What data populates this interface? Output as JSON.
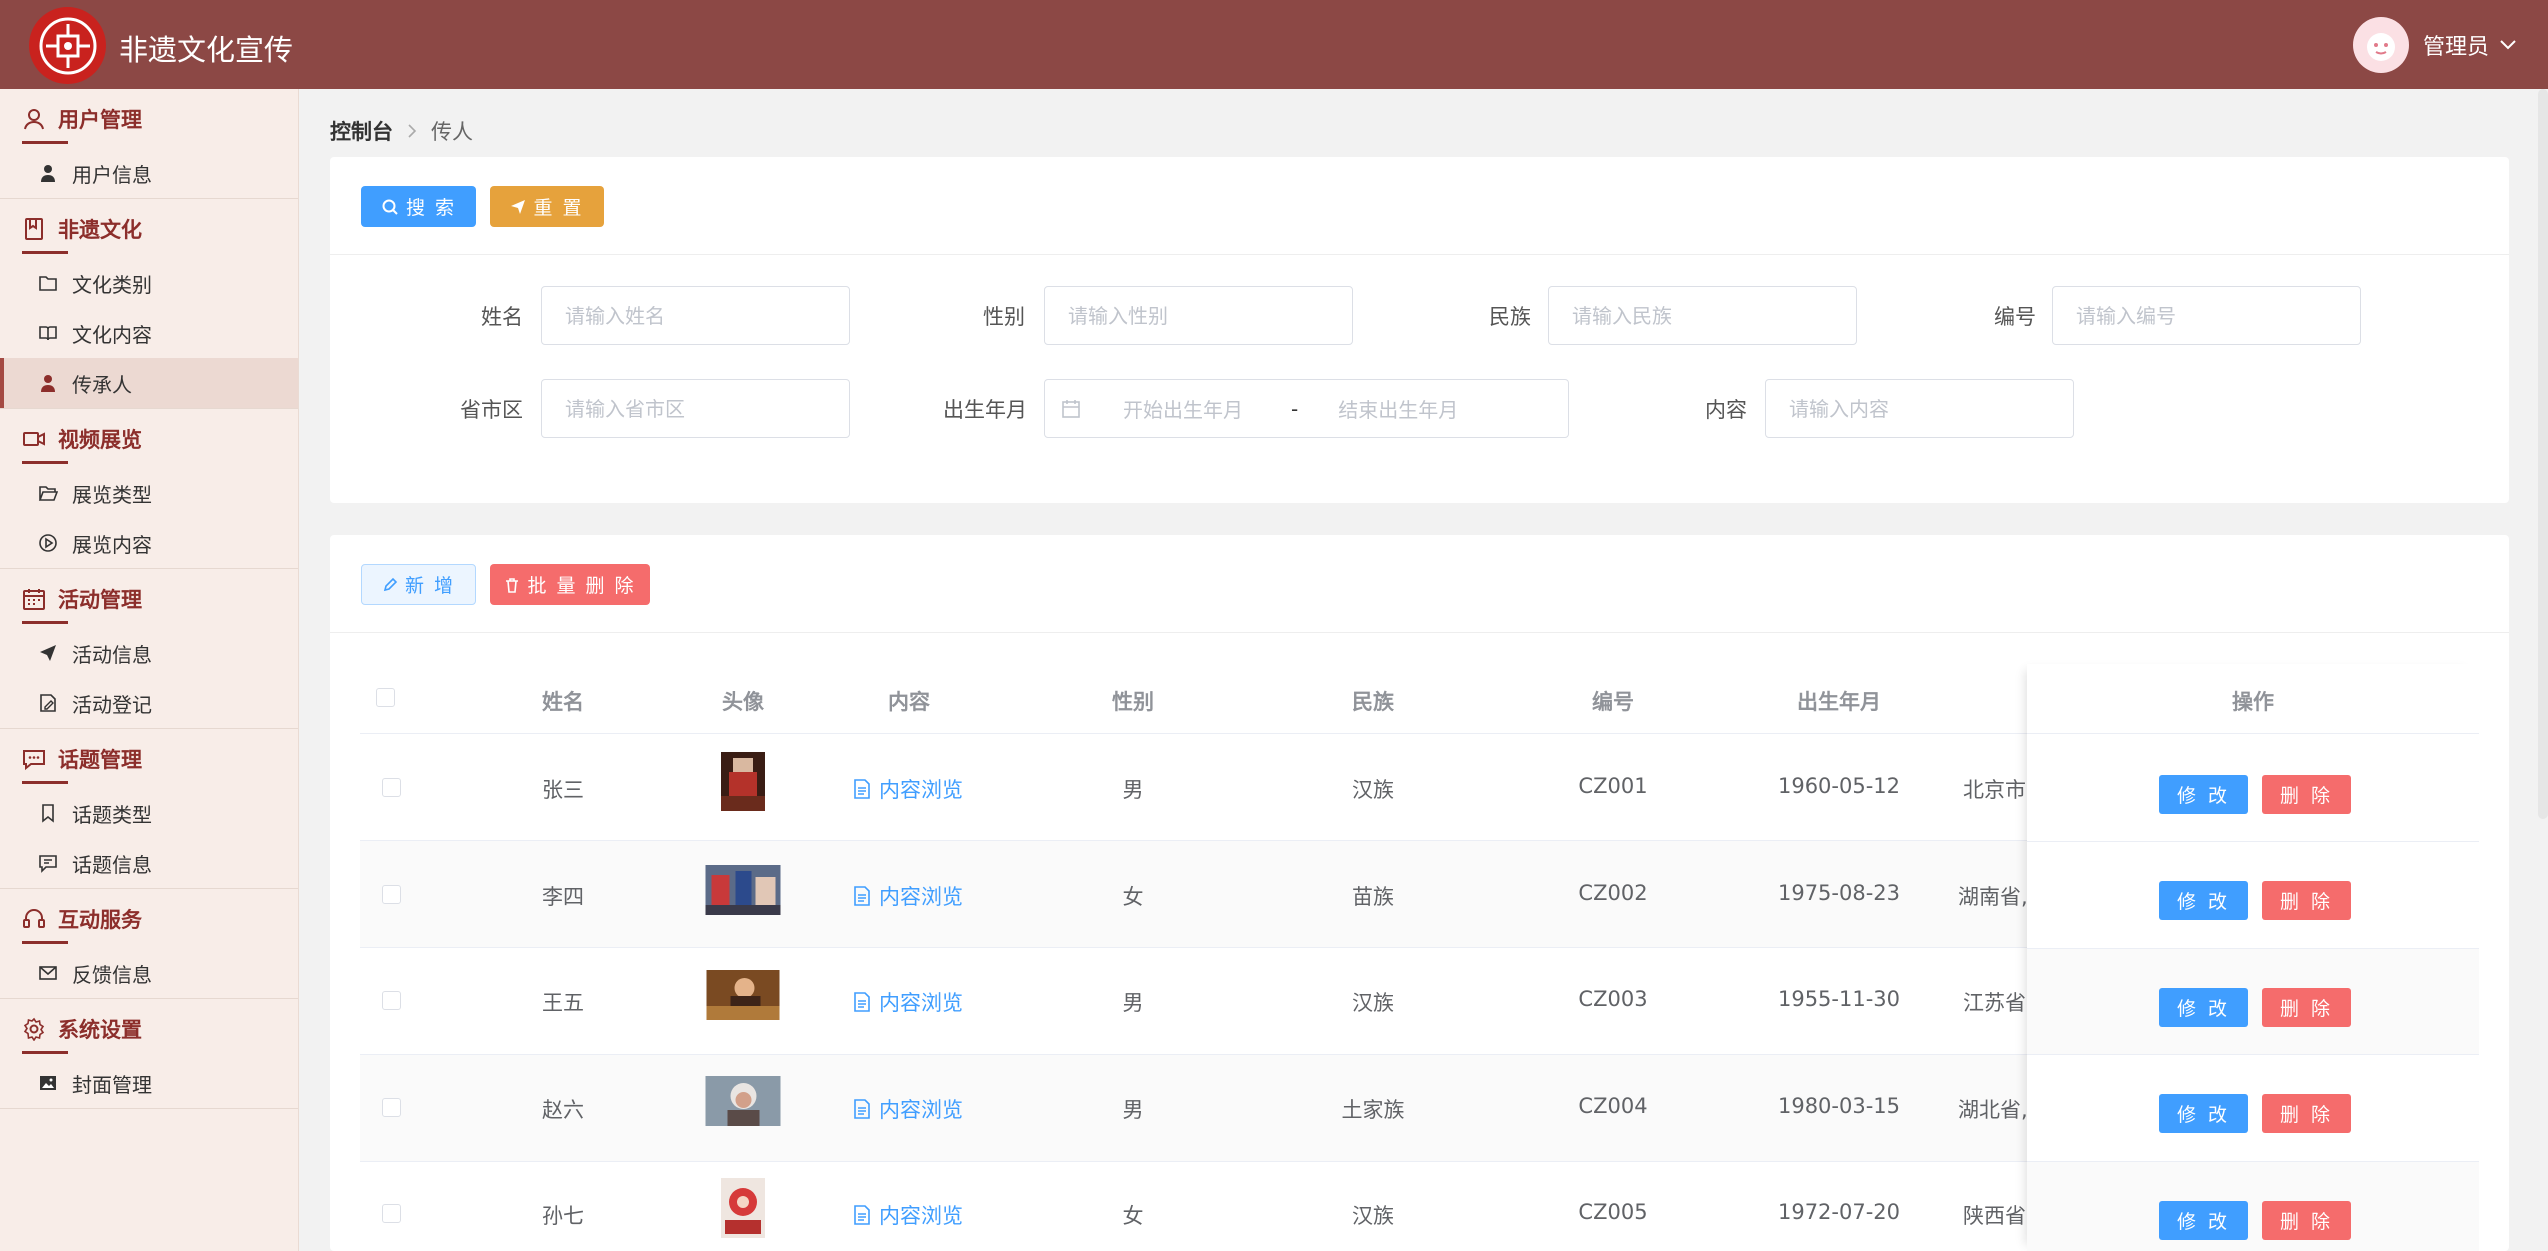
{
  "app": {
    "title": "非遗文化宣传",
    "user": "管理员"
  },
  "sidebar": {
    "groups": [
      {
        "label": "用户管理",
        "icon": "user-icon",
        "items": [
          {
            "label": "用户信息",
            "icon": "person-icon"
          }
        ]
      },
      {
        "label": "非遗文化",
        "icon": "book-icon",
        "items": [
          {
            "label": "文化类别",
            "icon": "folder-icon"
          },
          {
            "label": "文化内容",
            "icon": "open-book-icon"
          },
          {
            "label": "传承人",
            "icon": "person-icon"
          }
        ]
      },
      {
        "label": "视频展览",
        "icon": "video-icon",
        "items": [
          {
            "label": "展览类型",
            "icon": "folder-open-icon"
          },
          {
            "label": "展览内容",
            "icon": "play-circle-icon"
          }
        ]
      },
      {
        "label": "活动管理",
        "icon": "calendar-icon",
        "items": [
          {
            "label": "活动信息",
            "icon": "send-icon"
          },
          {
            "label": "活动登记",
            "icon": "edit-doc-icon"
          }
        ]
      },
      {
        "label": "话题管理",
        "icon": "chat-icon",
        "items": [
          {
            "label": "话题类型",
            "icon": "bookmark-icon"
          },
          {
            "label": "话题信息",
            "icon": "message-icon"
          }
        ]
      },
      {
        "label": "互动服务",
        "icon": "headset-icon",
        "items": [
          {
            "label": "反馈信息",
            "icon": "mail-icon"
          }
        ]
      },
      {
        "label": "系统设置",
        "icon": "gear-icon",
        "items": [
          {
            "label": "封面管理",
            "icon": "picture-icon"
          }
        ]
      }
    ],
    "active": "传承人"
  },
  "breadcrumb": {
    "home": "控制台",
    "current": "传人"
  },
  "search": {
    "search_label": "搜 索",
    "reset_label": "重 置",
    "fields": {
      "name": {
        "label": "姓名",
        "placeholder": "请输入姓名"
      },
      "gender": {
        "label": "性别",
        "placeholder": "请输入性别"
      },
      "ethnic": {
        "label": "民族",
        "placeholder": "请输入民族"
      },
      "code": {
        "label": "编号",
        "placeholder": "请输入编号"
      },
      "region": {
        "label": "省市区",
        "placeholder": "请输入省市区"
      },
      "birth": {
        "label": "出生年月",
        "start": "开始出生年月",
        "sep": "-",
        "end": "结束出生年月"
      },
      "content": {
        "label": "内容",
        "placeholder": "请输入内容"
      }
    }
  },
  "toolbar": {
    "add_label": "新 增",
    "batch_delete_label": "批 量 删 除"
  },
  "table": {
    "headers": {
      "name": "姓名",
      "avatar": "头像",
      "content": "内容",
      "gender": "性别",
      "ethnic": "民族",
      "code": "编号",
      "birth": "出生年月",
      "actions": "操作"
    },
    "view_label": "内容浏览",
    "edit_label": "修 改",
    "delete_label": "删 除",
    "rows": [
      {
        "name": "张三",
        "gender": "男",
        "ethnic": "汉族",
        "code": "CZ001",
        "birth": "1960-05-12",
        "region": "北京市,"
      },
      {
        "name": "李四",
        "gender": "女",
        "ethnic": "苗族",
        "code": "CZ002",
        "birth": "1975-08-23",
        "region": "湖南省,"
      },
      {
        "name": "王五",
        "gender": "男",
        "ethnic": "汉族",
        "code": "CZ003",
        "birth": "1955-11-30",
        "region": "江苏省,"
      },
      {
        "name": "赵六",
        "gender": "男",
        "ethnic": "土家族",
        "code": "CZ004",
        "birth": "1980-03-15",
        "region": "湖北省,"
      },
      {
        "name": "孙七",
        "gender": "女",
        "ethnic": "汉族",
        "code": "CZ005",
        "birth": "1972-07-20",
        "region": "陕西省,"
      }
    ]
  },
  "colors": {
    "header": "#8c4845",
    "primary": "#409eff",
    "warning": "#e6a23c",
    "danger": "#f56c6c",
    "sidebar_accent": "#8c2e2b"
  }
}
